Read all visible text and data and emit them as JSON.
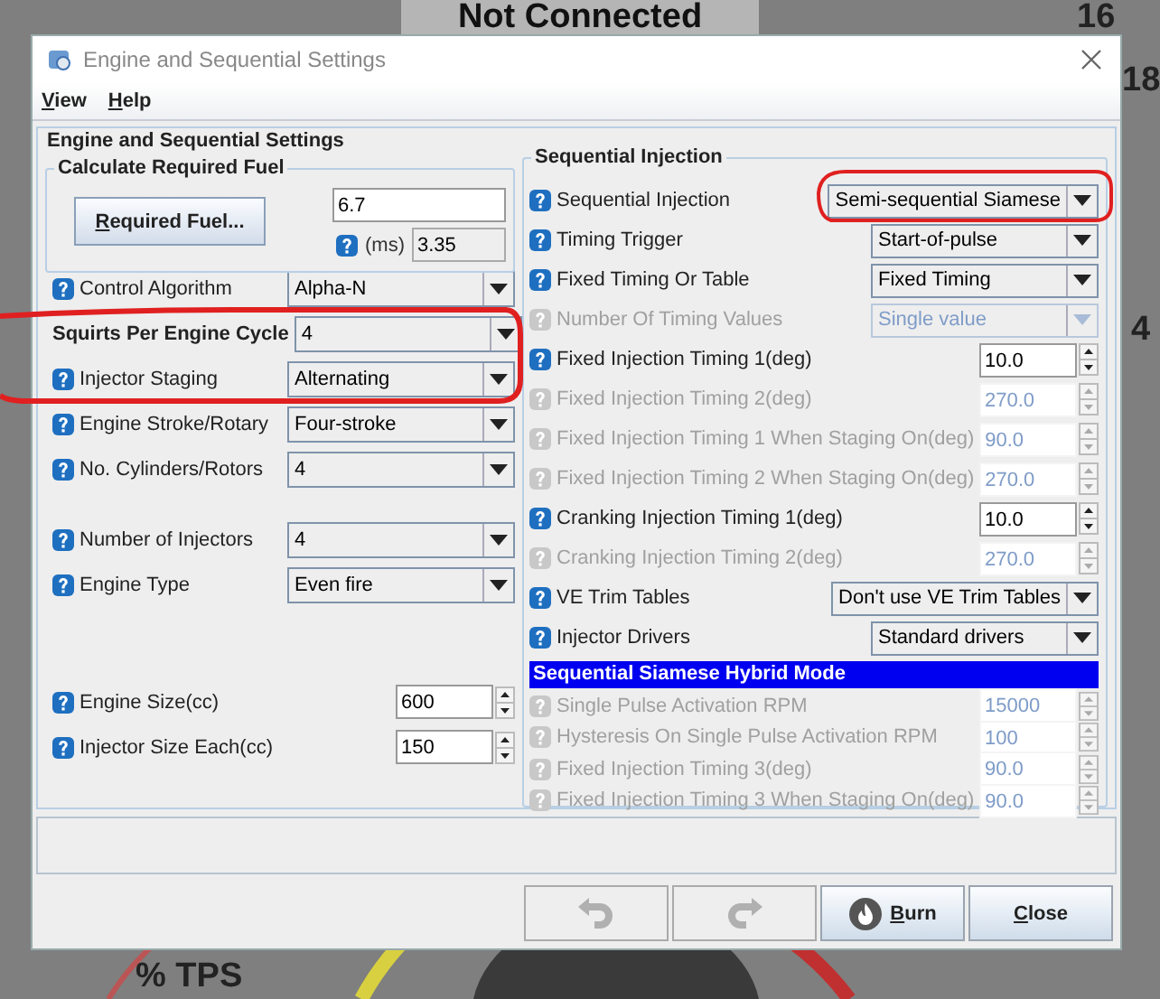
{
  "dashboard": {
    "status": "Not Connected",
    "labels": [
      {
        "text": "16",
        "kind": "top-right"
      },
      {
        "text": "18",
        "kind": "right-high"
      },
      {
        "text": "4",
        "kind": "right-mid"
      },
      {
        "text": "% TPS",
        "kind": "bottom-left"
      }
    ]
  },
  "window": {
    "title": "Engine and Sequential Settings"
  },
  "menu": [
    "View",
    "Help"
  ],
  "panel_title": "Engine and Sequential Settings",
  "required_fuel": {
    "title": "Calculate Required Fuel",
    "button": "Required Fuel...",
    "value": "6.7",
    "unit": "(ms)",
    "ms_value": "3.35"
  },
  "left_groups": [
    [
      {
        "kind": "select",
        "label": "Control Algorithm",
        "value": "Alpha-N",
        "help": true,
        "bold": false
      },
      {
        "kind": "select",
        "label": "Squirts Per Engine Cycle",
        "value": "4",
        "help": false,
        "bold": true
      },
      {
        "kind": "select",
        "label": "Injector Staging",
        "value": "Alternating",
        "help": true,
        "bold": false
      },
      {
        "kind": "select",
        "label": "Engine Stroke/Rotary",
        "value": "Four-stroke",
        "help": true,
        "bold": false
      },
      {
        "kind": "select",
        "label": "No. Cylinders/Rotors",
        "value": "4",
        "help": true,
        "bold": false
      }
    ],
    [
      {
        "kind": "select",
        "label": "Number of Injectors",
        "value": "4",
        "help": true,
        "bold": false
      },
      {
        "kind": "select",
        "label": "Engine Type",
        "value": "Even fire",
        "help": true,
        "bold": false
      }
    ],
    [
      {
        "kind": "spin",
        "label": "Engine Size(cc)",
        "value": "600",
        "help": true,
        "bold": false
      },
      {
        "kind": "spin",
        "label": "Injector Size Each(cc)",
        "value": "150",
        "help": true,
        "bold": false
      }
    ]
  ],
  "sequential": {
    "title": "Sequential Injection",
    "rows": [
      {
        "kind": "select",
        "label": "Sequential Injection",
        "value": "Semi-sequential Siamese",
        "disabled": false
      },
      {
        "kind": "select",
        "label": "Timing Trigger",
        "value": "Start-of-pulse",
        "disabled": false
      },
      {
        "kind": "select",
        "label": "Fixed Timing Or Table",
        "value": "Fixed Timing",
        "disabled": false
      },
      {
        "kind": "select",
        "label": "Number Of Timing Values",
        "value": "Single value",
        "disabled": true
      },
      {
        "kind": "spin",
        "label": "Fixed Injection Timing 1(deg)",
        "value": "10.0",
        "disabled": false
      },
      {
        "kind": "spin",
        "label": "Fixed Injection Timing 2(deg)",
        "value": "270.0",
        "disabled": true
      },
      {
        "kind": "spin",
        "label": "Fixed Injection Timing 1 When Staging On(deg)",
        "value": "90.0",
        "disabled": true
      },
      {
        "kind": "spin",
        "label": "Fixed Injection Timing 2 When Staging On(deg)",
        "value": "270.0",
        "disabled": true
      },
      {
        "kind": "spin",
        "label": "Cranking Injection Timing 1(deg)",
        "value": "10.0",
        "disabled": false
      },
      {
        "kind": "spin",
        "label": "Cranking Injection Timing 2(deg)",
        "value": "270.0",
        "disabled": true
      },
      {
        "kind": "select",
        "label": "VE Trim Tables",
        "value": "Don't use VE Trim Tables",
        "disabled": false
      },
      {
        "kind": "select",
        "label": "Injector Drivers",
        "value": "Standard drivers",
        "disabled": false
      }
    ],
    "hybrid_title": "Sequential Siamese Hybrid Mode",
    "hybrid_rows": [
      {
        "kind": "spin",
        "label": "Single Pulse Activation RPM",
        "value": "15000",
        "disabled": true
      },
      {
        "kind": "spin",
        "label": "Hysteresis On Single Pulse Activation RPM",
        "value": "100",
        "disabled": true
      },
      {
        "kind": "spin",
        "label": "Fixed Injection Timing 3(deg)",
        "value": "90.0",
        "disabled": true
      },
      {
        "kind": "spin",
        "label": "Fixed Injection Timing 3 When Staging On(deg)",
        "value": "90.0",
        "disabled": true
      }
    ]
  },
  "buttons": [
    {
      "kind": "undo",
      "disabled": true
    },
    {
      "kind": "redo",
      "disabled": true
    },
    {
      "kind": "burn",
      "label": "Burn",
      "disabled": false
    },
    {
      "kind": "close",
      "label": "Close",
      "disabled": false
    }
  ]
}
